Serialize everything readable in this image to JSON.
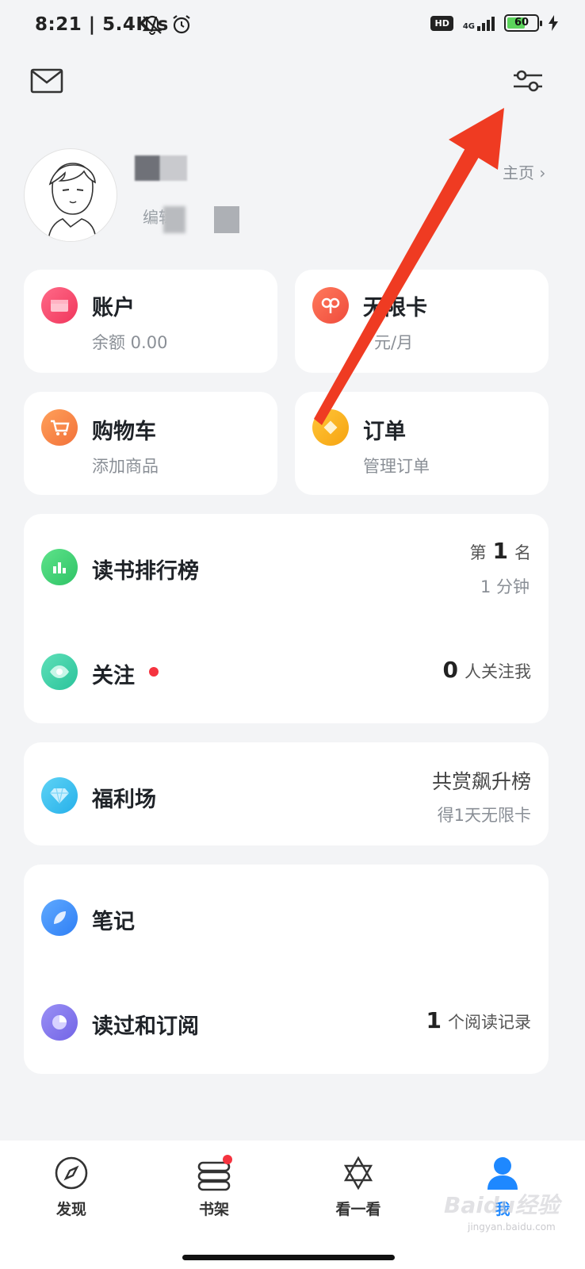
{
  "status_bar": {
    "time_speed": "8:21 | 5.4K/s",
    "hd_badge": "HD",
    "network": "4G",
    "battery": "60"
  },
  "profile": {
    "edit_label": "编辑",
    "homepage_link": "主页 ›"
  },
  "cards": {
    "account": {
      "title": "账户",
      "sub": "余额 0.00"
    },
    "unlimited": {
      "title": "无限卡",
      "sub": "元/月"
    },
    "cart": {
      "title": "购物车",
      "sub": "添加商品"
    },
    "orders": {
      "title": "订单",
      "sub": "管理订单"
    },
    "ranking": {
      "title": "读书排行榜",
      "rank_prefix": "第",
      "rank_value": "1",
      "rank_suffix": "名",
      "time": "1 分钟"
    },
    "follow": {
      "title": "关注",
      "count": "0",
      "count_label": "人关注我"
    },
    "welfare": {
      "title": "福利场",
      "right_main": "共赏飙升榜",
      "right_sub": "得1天无限卡"
    },
    "notes": {
      "title": "笔记"
    },
    "read_subscribed": {
      "title": "读过和订阅",
      "count": "1",
      "count_label": "个阅读记录"
    }
  },
  "nav": {
    "discover": "发现",
    "shelf": "书架",
    "look": "看一看",
    "me": "我"
  },
  "watermark": {
    "main": "Baidu经验",
    "sub": "jingyan.baidu.com"
  },
  "colors": {
    "background": "#f3f4f6",
    "card": "#ffffff",
    "annotation_arrow": "#ef3b22",
    "active_tab": "#1e88ff",
    "badge_red": "#f5333f"
  }
}
